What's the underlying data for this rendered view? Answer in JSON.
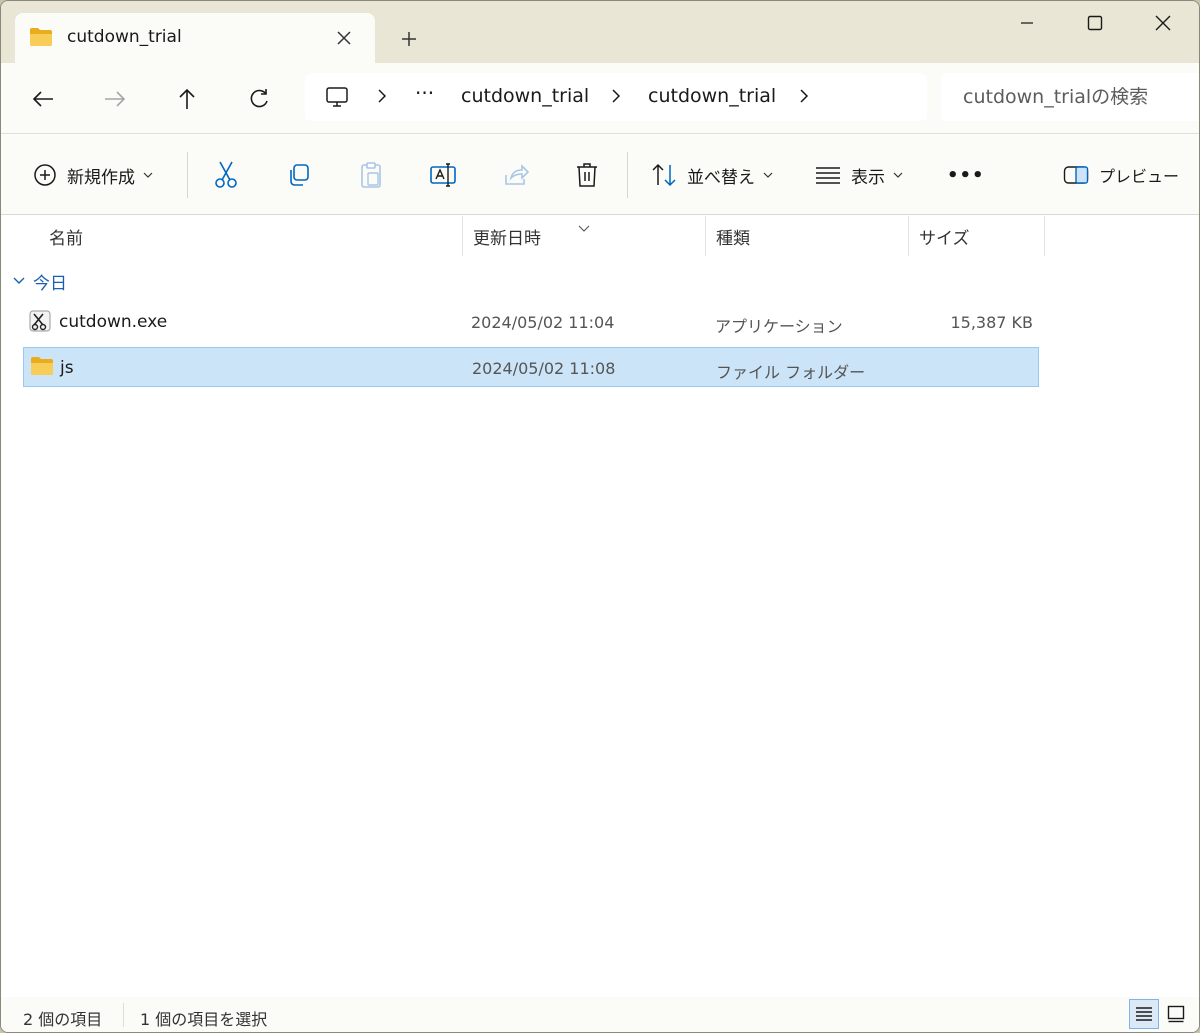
{
  "tab": {
    "title": "cutdown_trial"
  },
  "address": {
    "ellipsis": "···",
    "crumbs": [
      "cutdown_trial",
      "cutdown_trial"
    ]
  },
  "search": {
    "placeholder": "cutdown_trialの検索"
  },
  "toolbar": {
    "new_label": "新規作成",
    "sort_label": "並べ替え",
    "view_label": "表示",
    "more_label": "•••",
    "preview_label": "プレビュー"
  },
  "columns": {
    "name": "名前",
    "modified": "更新日時",
    "type": "種類",
    "size": "サイズ"
  },
  "group": {
    "label": "今日"
  },
  "files": [
    {
      "name": "cutdown.exe",
      "modified": "2024/05/02 11:04",
      "type": "アプリケーション",
      "size": "15,387 KB",
      "icon": "application-icon"
    },
    {
      "name": "js",
      "modified": "2024/05/02 11:08",
      "type": "ファイル フォルダー",
      "size": "",
      "icon": "folder-icon"
    }
  ],
  "status": {
    "count": "2 個の項目",
    "selected": "1 個の項目を選択"
  },
  "colors": {
    "accent": "#0067c0",
    "selection": "#cce4f7",
    "folder": "#f4c542"
  }
}
